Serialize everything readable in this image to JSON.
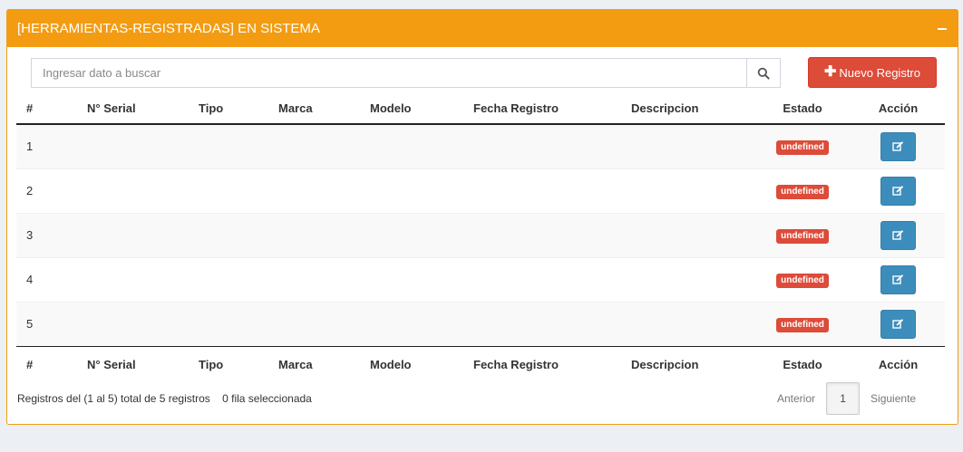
{
  "panel": {
    "title": "[HERRAMIENTAS-REGISTRADAS] EN SISTEMA",
    "collapse_icon": "minus-icon"
  },
  "search": {
    "placeholder": "Ingresar dato a buscar",
    "icon": "search-icon"
  },
  "new_button": {
    "icon": "plus-icon",
    "label": "Nuevo Registro"
  },
  "colors": {
    "header": "#f39c12",
    "danger": "#dd4b39",
    "primary": "#3c8dbc"
  },
  "table": {
    "columns": [
      "#",
      "N° Serial",
      "Tipo",
      "Marca",
      "Modelo",
      "Fecha Registro",
      "Descripcion",
      "Estado",
      "Acción"
    ],
    "rows": [
      {
        "num": "1",
        "estado": "undefined"
      },
      {
        "num": "2",
        "estado": "undefined"
      },
      {
        "num": "3",
        "estado": "undefined"
      },
      {
        "num": "4",
        "estado": "undefined"
      },
      {
        "num": "5",
        "estado": "undefined"
      }
    ],
    "action_icon": "edit-icon"
  },
  "footer": {
    "info": "Registros del (1 al 5) total de 5 registros",
    "selected": "0 fila seleccionada",
    "prev": "Anterior",
    "page": "1",
    "next": "Siguiente"
  }
}
